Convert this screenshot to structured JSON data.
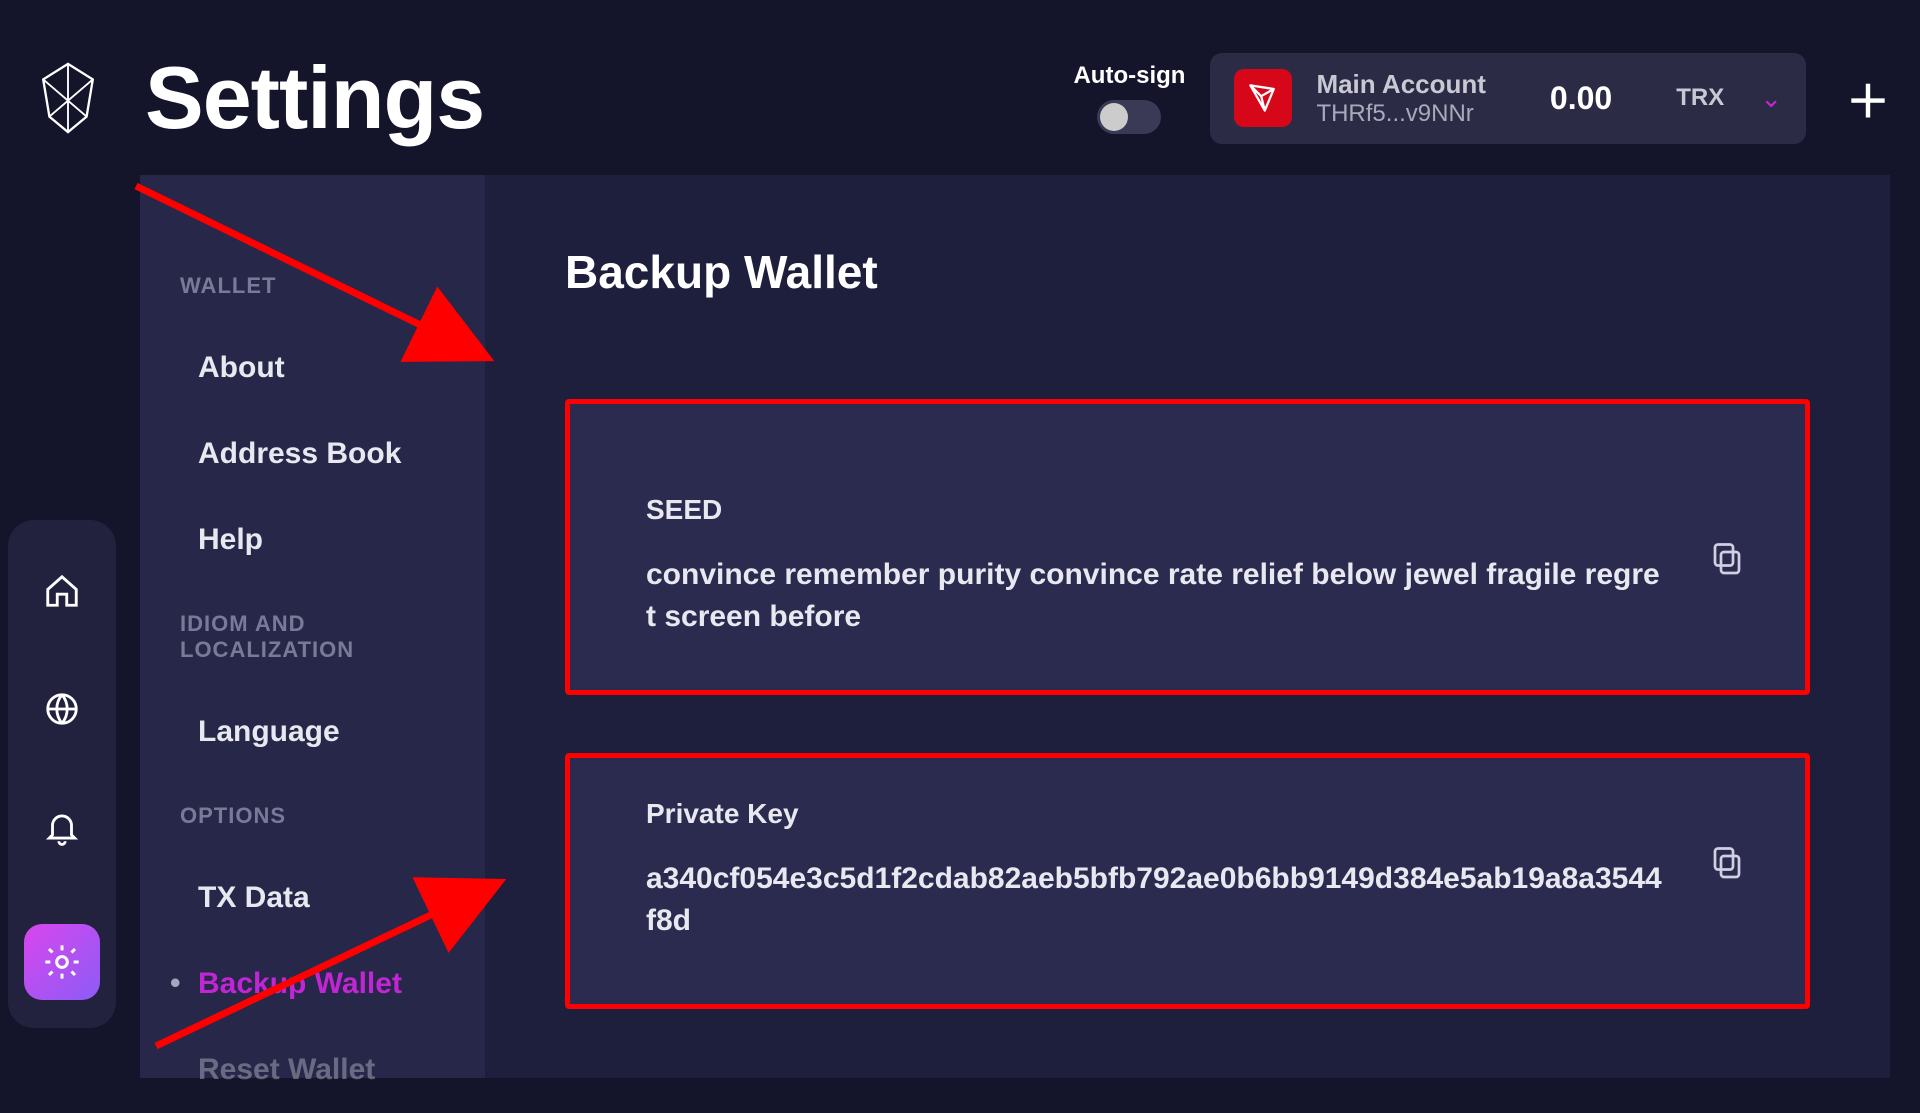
{
  "header": {
    "page_title": "Settings",
    "autosign_label": "Auto-sign",
    "account": {
      "name": "Main Account",
      "address": "THRf5...v9NNr",
      "balance": "0.00",
      "symbol": "TRX"
    }
  },
  "leftrail": {
    "items": [
      "home-icon",
      "globe-icon",
      "bell-icon",
      "gear-icon"
    ],
    "active": "gear-icon"
  },
  "sidebar": {
    "sections": [
      {
        "label": "WALLET",
        "items": [
          {
            "label": "About"
          },
          {
            "label": "Address Book"
          },
          {
            "label": "Help"
          }
        ]
      },
      {
        "label": "IDIOM AND LOCALIZATION",
        "items": [
          {
            "label": "Language"
          }
        ]
      },
      {
        "label": "OPTIONS",
        "items": [
          {
            "label": "TX Data"
          },
          {
            "label": "Backup Wallet",
            "active": true
          },
          {
            "label": "Reset Wallet"
          }
        ]
      }
    ]
  },
  "content": {
    "title": "Backup Wallet",
    "cards": [
      {
        "label": "SEED",
        "value": "convince remember purity convince rate relief below jewel fragile regret screen before"
      },
      {
        "label": "Private Key",
        "value": "a340cf054e3c5d1f2cdab82aeb5bfb792ae0b6bb9149d384e5ab19a8a3544f8d"
      }
    ]
  }
}
